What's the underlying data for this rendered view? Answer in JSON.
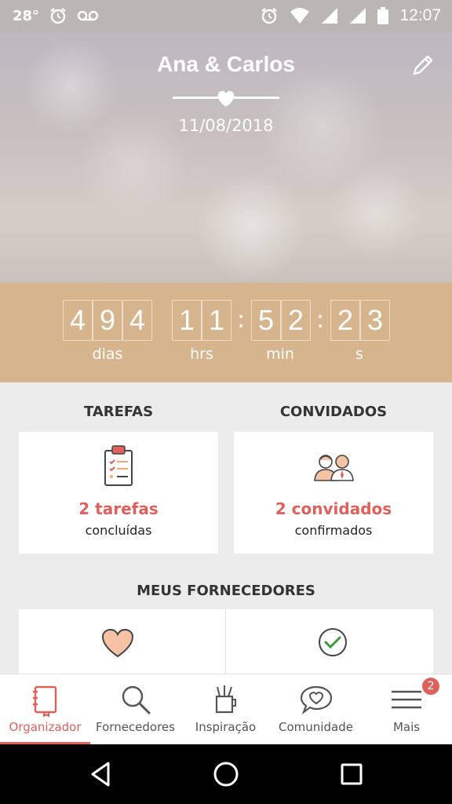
{
  "status_bar": {
    "temp": "28°",
    "time": "12:07"
  },
  "header": {
    "couple": "Ana & Carlos",
    "date": "11/08/2018"
  },
  "countdown": {
    "days": [
      "4",
      "9",
      "4"
    ],
    "hours": [
      "1",
      "1"
    ],
    "minutes": [
      "5",
      "2"
    ],
    "seconds": [
      "2",
      "3"
    ],
    "separator": ":",
    "labels": {
      "days": "dias",
      "hours": "hrs",
      "minutes": "min",
      "seconds": "s"
    }
  },
  "tasks": {
    "title": "TAREFAS",
    "count": "2 tarefas",
    "sub": "concluídas"
  },
  "guests": {
    "title": "CONVIDADOS",
    "count": "2 convidados",
    "sub": "confirmados"
  },
  "providers": {
    "title": "MEUS FORNECEDORES"
  },
  "bottom_nav": [
    {
      "label": "Organizador",
      "icon": "notebook-icon",
      "active": true
    },
    {
      "label": "Fornecedores",
      "icon": "search-icon"
    },
    {
      "label": "Inspiração",
      "icon": "pencil-cup-icon"
    },
    {
      "label": "Comunidade",
      "icon": "heart-bubble-icon"
    },
    {
      "label": "Mais",
      "icon": "menu-icon",
      "badge": "2"
    }
  ],
  "colors": {
    "accent": "#e0615b",
    "countdown_bg": "#d6b48d",
    "heart": "#f6c2a4",
    "check": "#3c9a3c"
  }
}
